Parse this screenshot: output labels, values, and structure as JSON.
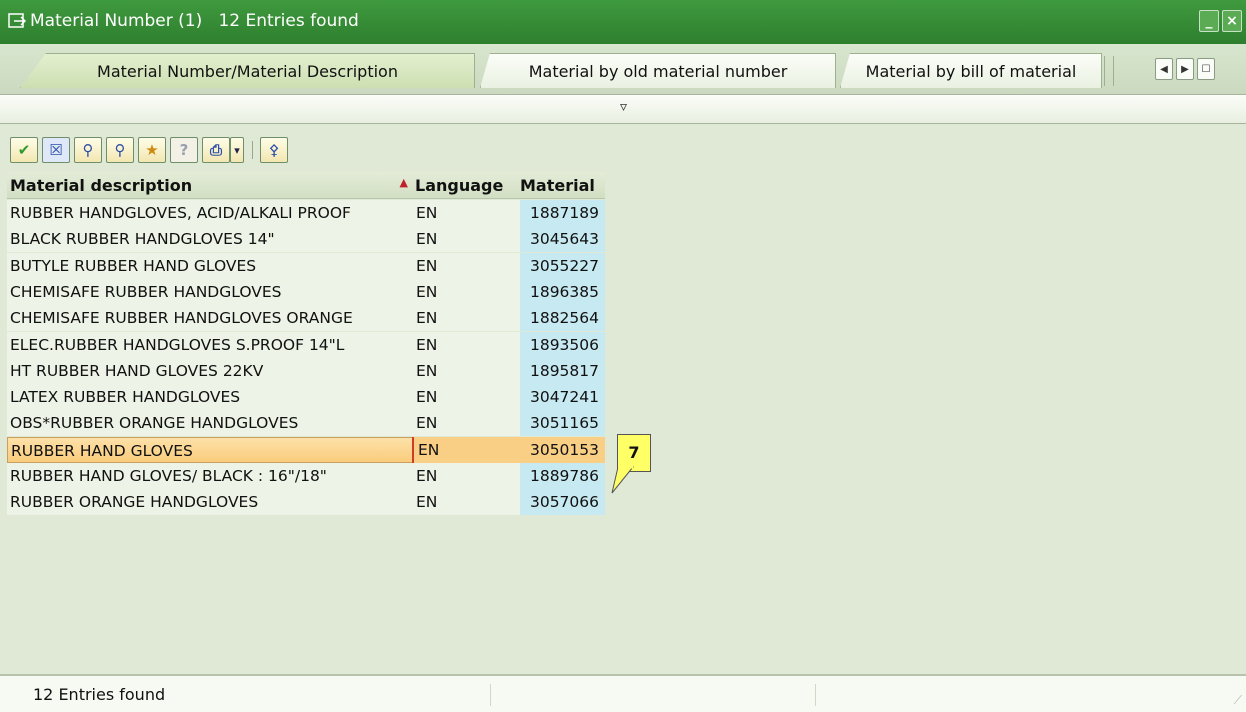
{
  "window": {
    "title": "Material Number (1)   12 Entries found",
    "minimize_glyph": "_",
    "close_glyph": "×"
  },
  "tabs": [
    {
      "label": "Material Number/Material Description",
      "active": true
    },
    {
      "label": "Material by old material number",
      "active": false
    },
    {
      "label": "Material by bill of material",
      "active": false
    }
  ],
  "tab_nav": {
    "prev_glyph": "◀",
    "next_glyph": "▶",
    "list_glyph": "☐"
  },
  "splitter": {
    "glyph": "▿"
  },
  "toolbar": {
    "buttons": [
      {
        "icon": "checkmark-icon",
        "glyph": "✔"
      },
      {
        "icon": "cancel-icon",
        "glyph": "☒"
      },
      {
        "icon": "find-icon",
        "glyph": "⚲"
      },
      {
        "icon": "find-next-icon",
        "glyph": "⚲"
      },
      {
        "icon": "add-favorite-icon",
        "glyph": "★"
      },
      {
        "icon": "help-icon",
        "glyph": "?"
      },
      {
        "icon": "print-icon",
        "glyph": "⎙"
      },
      {
        "icon": "dropdown-icon",
        "glyph": "▾"
      },
      {
        "icon": "pin-icon",
        "glyph": "⚴"
      }
    ]
  },
  "table": {
    "columns": [
      "Material description",
      "Language",
      "Material"
    ],
    "sort_glyph": "▲",
    "rows": [
      {
        "desc": "RUBBER HANDGLOVES, ACID/ALKALI PROOF",
        "lang": "EN",
        "mat": "1887189"
      },
      {
        "desc": "BLACK RUBBER HANDGLOVES 14\"",
        "lang": "EN",
        "mat": "3045643"
      },
      {
        "desc": "BUTYLE RUBBER HAND GLOVES",
        "lang": "EN",
        "mat": "3055227"
      },
      {
        "desc": "CHEMISAFE RUBBER HANDGLOVES",
        "lang": "EN",
        "mat": "1896385"
      },
      {
        "desc": "CHEMISAFE RUBBER HANDGLOVES ORANGE",
        "lang": "EN",
        "mat": "1882564"
      },
      {
        "desc": "ELEC.RUBBER HANDGLOVES S.PROOF 14\"L",
        "lang": "EN",
        "mat": "1893506"
      },
      {
        "desc": "HT RUBBER HAND GLOVES 22KV",
        "lang": "EN",
        "mat": "1895817"
      },
      {
        "desc": "LATEX RUBBER HANDGLOVES",
        "lang": "EN",
        "mat": "3047241"
      },
      {
        "desc": "OBS*RUBBER ORANGE HANDGLOVES",
        "lang": "EN",
        "mat": "3051165"
      },
      {
        "desc": "RUBBER HAND GLOVES",
        "lang": "EN",
        "mat": "3050153",
        "selected": true
      },
      {
        "desc": "RUBBER HAND GLOVES/ BLACK : 16\"/18\"",
        "lang": "EN",
        "mat": "1889786"
      },
      {
        "desc": "RUBBER ORANGE HANDGLOVES",
        "lang": "EN",
        "mat": "3057066"
      }
    ]
  },
  "callout": {
    "text": "7"
  },
  "status": {
    "text": "12 Entries found"
  },
  "colors": {
    "titlebar": "#3f9a3e",
    "background": "#dfe9d6",
    "material_column": "#c7e9f1",
    "selected_row": "#f9cf85",
    "callout": "#ffff66"
  }
}
